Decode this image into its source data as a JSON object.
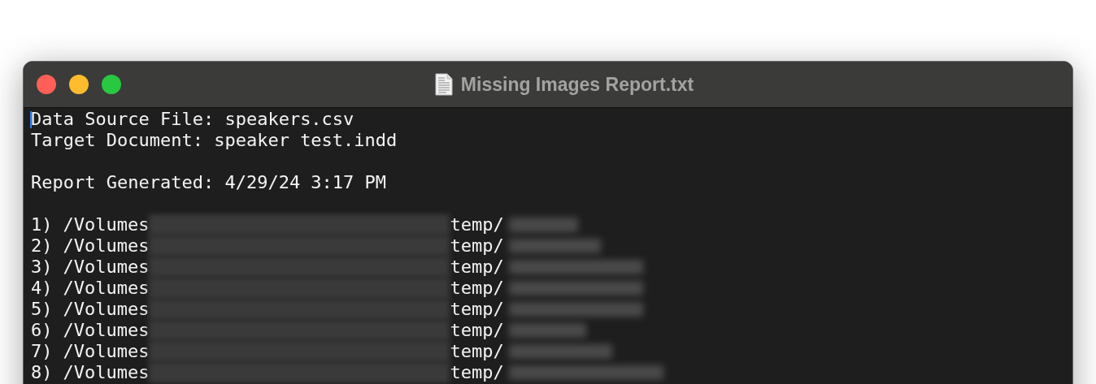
{
  "window": {
    "title": "Missing Images Report.txt"
  },
  "header_blocks": [
    [
      "Data Source File: speakers.csv",
      "Target Document: speaker test.indd"
    ],
    [
      "Report Generated: 4/29/24 3:17 PM"
    ]
  ],
  "entries": [
    {
      "number": "1)",
      "prefix": "/Volumes",
      "folder": "temp/"
    },
    {
      "number": "2)",
      "prefix": "/Volumes",
      "folder": "temp/"
    },
    {
      "number": "3)",
      "prefix": "/Volumes",
      "folder": "temp/"
    },
    {
      "number": "4)",
      "prefix": "/Volumes",
      "folder": "temp/"
    },
    {
      "number": "5)",
      "prefix": "/Volumes",
      "folder": "temp/"
    },
    {
      "number": "6)",
      "prefix": "/Volumes",
      "folder": "temp/"
    },
    {
      "number": "7)",
      "prefix": "/Volumes",
      "folder": "temp/"
    },
    {
      "number": "8)",
      "prefix": "/Volumes",
      "folder": "temp/"
    }
  ]
}
